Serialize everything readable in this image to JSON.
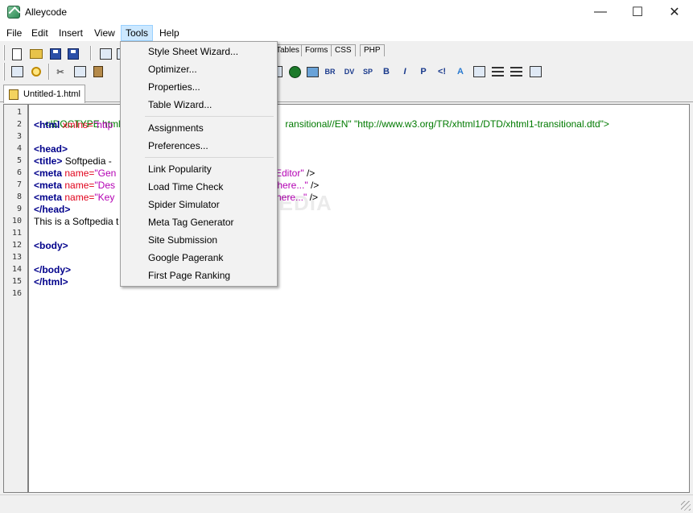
{
  "app": {
    "title": "Alleycode"
  },
  "window_controls": {
    "minimize": "—",
    "maximize": "☐",
    "close": "✕"
  },
  "menu": [
    "File",
    "Edit",
    "Insert",
    "View",
    "Tools",
    "Help"
  ],
  "toolbar_tabs": [
    "Tables",
    "Forms",
    "CSS",
    "PHP"
  ],
  "format_buttons": [
    "BR",
    "DV",
    "SP",
    "B",
    "P"
  ],
  "document_tab": {
    "label": "Untitled-1.html"
  },
  "tools_menu": {
    "items": [
      "Style Sheet Wizard...",
      "Optimizer...",
      "Properties...",
      "Table Wizard...",
      "Assignments",
      "Preferences...",
      "Link Popularity",
      "Load Time Check",
      "Spider Simulator",
      "Meta Tag Generator",
      "Site Submission",
      "Google Pagerank",
      "First Page Ranking"
    ]
  },
  "editor": {
    "line_numbers": [
      "1",
      "2",
      "3",
      "4",
      "5",
      "6",
      "7",
      "8",
      "9",
      "10",
      "11",
      "12",
      "13",
      "14",
      "15",
      "16"
    ],
    "fragments": {
      "l1a": "<!DOCTYPE html PU",
      "l1b": "ransitional//EN\" \"http://www.w3.org/TR/xhtml1/DTD/xhtml1-transitional.dtd\">",
      "l2a": "<html",
      "l2b": " xmlns=",
      "l2c": "\"http",
      "l4": "<head>",
      "l5a": "<title>",
      "l5b": " Softpedia -",
      "l6a": "<meta",
      "l6b": " name=",
      "l6c": "\"Gen",
      "l6d": "Editor\"",
      "l6e": " />",
      "l7a": "<meta",
      "l7b": " name=",
      "l7c": "\"Des",
      "l7d": " here...\"",
      "l7e": " />",
      "l8a": "<meta",
      "l8b": " name=",
      "l8c": "\"Key",
      "l8d": "here...\"",
      "l8e": " />",
      "l9": "</head>",
      "l10": "This is a Softpedia t",
      "l12": "<body>",
      "l14": "</body>",
      "l15": "</html>"
    }
  },
  "watermark": "SOFTPEDIA"
}
